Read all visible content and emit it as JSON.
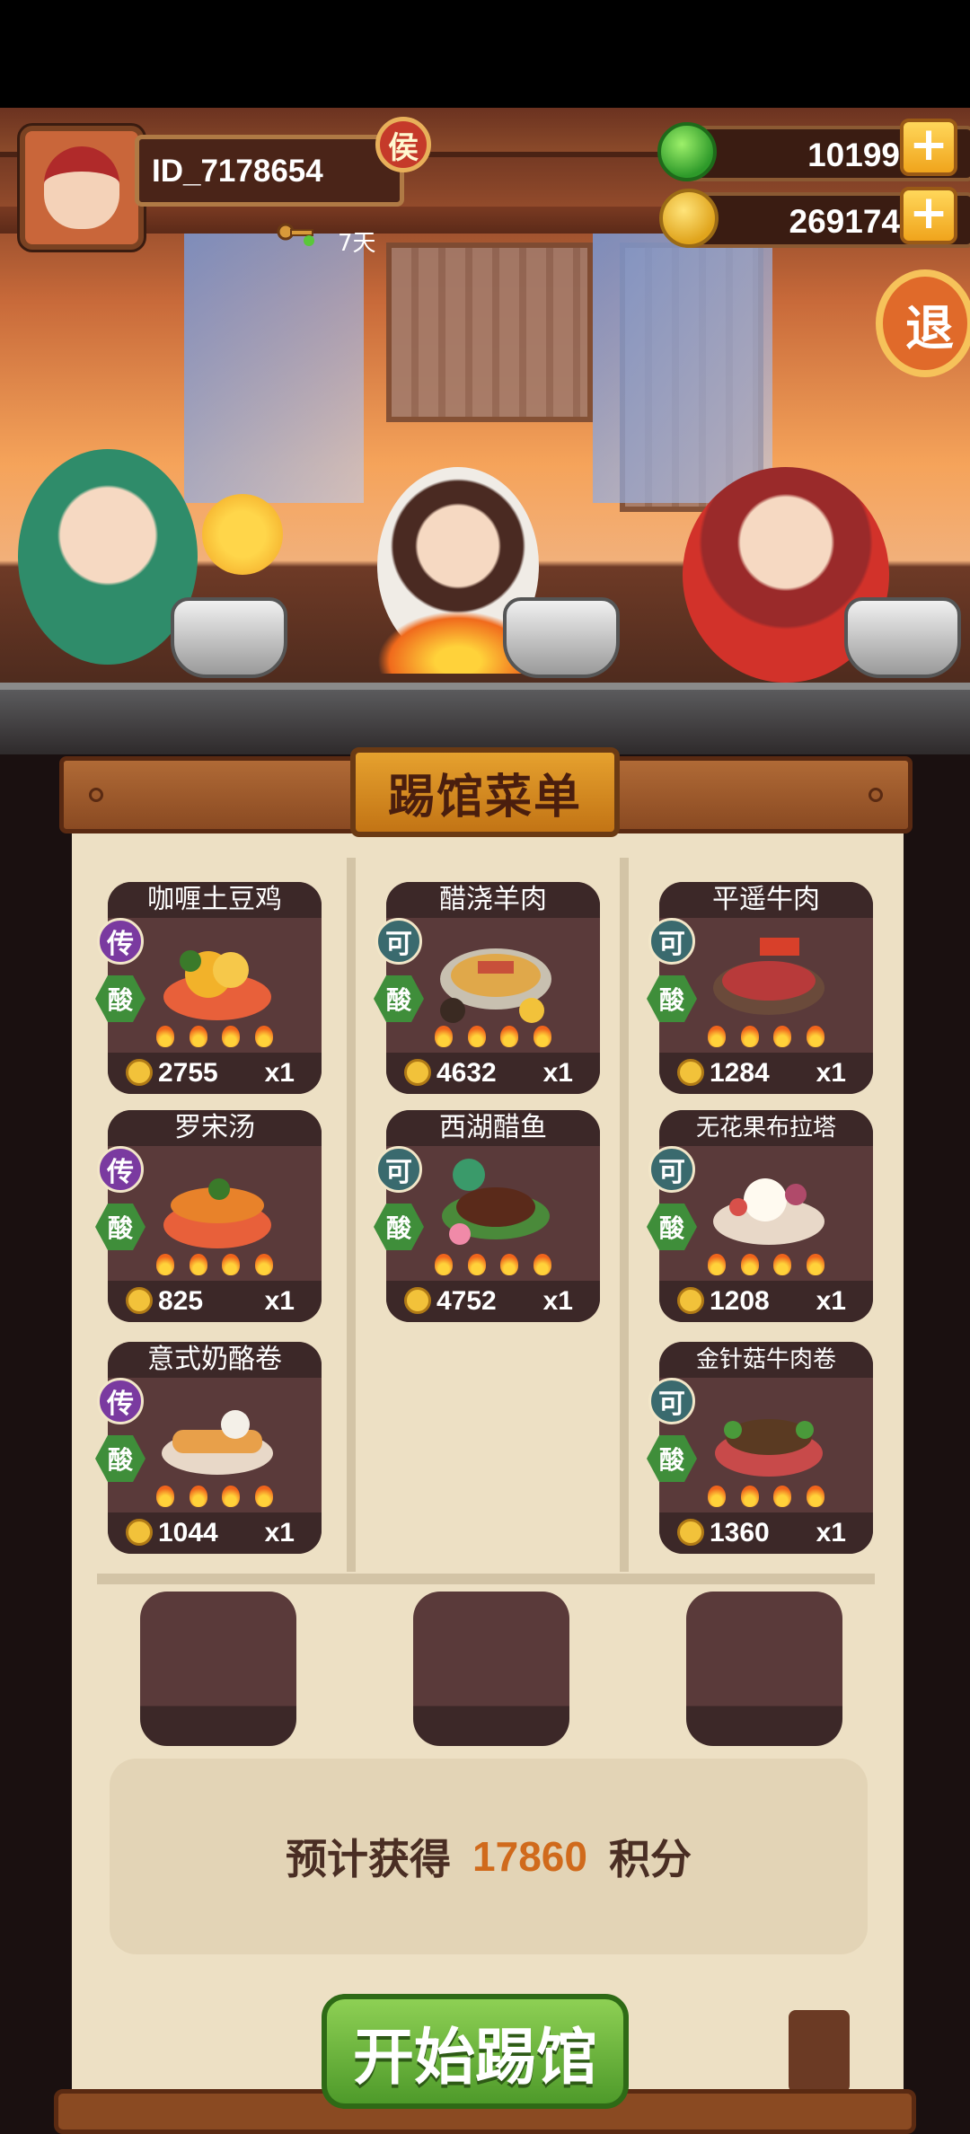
{
  "player": {
    "id": "ID_7178654",
    "badge": "侯",
    "days": "7天"
  },
  "resources": {
    "jade": "10199",
    "coins": "269174",
    "plus": "+"
  },
  "exit_label": "退",
  "menu_title": "踢馆菜单",
  "dishes": [
    {
      "name": "咖喱土豆鸡",
      "rank": "传",
      "taste": "酸",
      "price": "2755",
      "qty": "x1"
    },
    {
      "name": "醋浇羊肉",
      "rank": "可",
      "taste": "酸",
      "price": "4632",
      "qty": "x1"
    },
    {
      "name": "平遥牛肉",
      "rank": "可",
      "taste": "酸",
      "price": "1284",
      "qty": "x1"
    },
    {
      "name": "罗宋汤",
      "rank": "传",
      "taste": "酸",
      "price": "825",
      "qty": "x1"
    },
    {
      "name": "西湖醋鱼",
      "rank": "可",
      "taste": "酸",
      "price": "4752",
      "qty": "x1"
    },
    {
      "name": "无花果布拉塔",
      "rank": "可",
      "taste": "酸",
      "price": "1208",
      "qty": "x1"
    },
    {
      "name": "意式奶酪卷",
      "rank": "传",
      "taste": "酸",
      "price": "1044",
      "qty": "x1"
    },
    {
      "name": "金针菇牛肉卷",
      "rank": "可",
      "taste": "酸",
      "price": "1360",
      "qty": "x1"
    }
  ],
  "score": {
    "prefix": "预计获得",
    "value": "17860",
    "suffix": "积分"
  },
  "start_button": "开始踢馆",
  "colors": {
    "accent_orange": "#d06a1c",
    "start_green": "#6cb63e",
    "panel_bg": "#ede0c4",
    "card_bg": "#5a3a3a"
  },
  "icons": {
    "jade": "jade-icon",
    "coin": "coin-icon",
    "plus": "plus-icon"
  }
}
